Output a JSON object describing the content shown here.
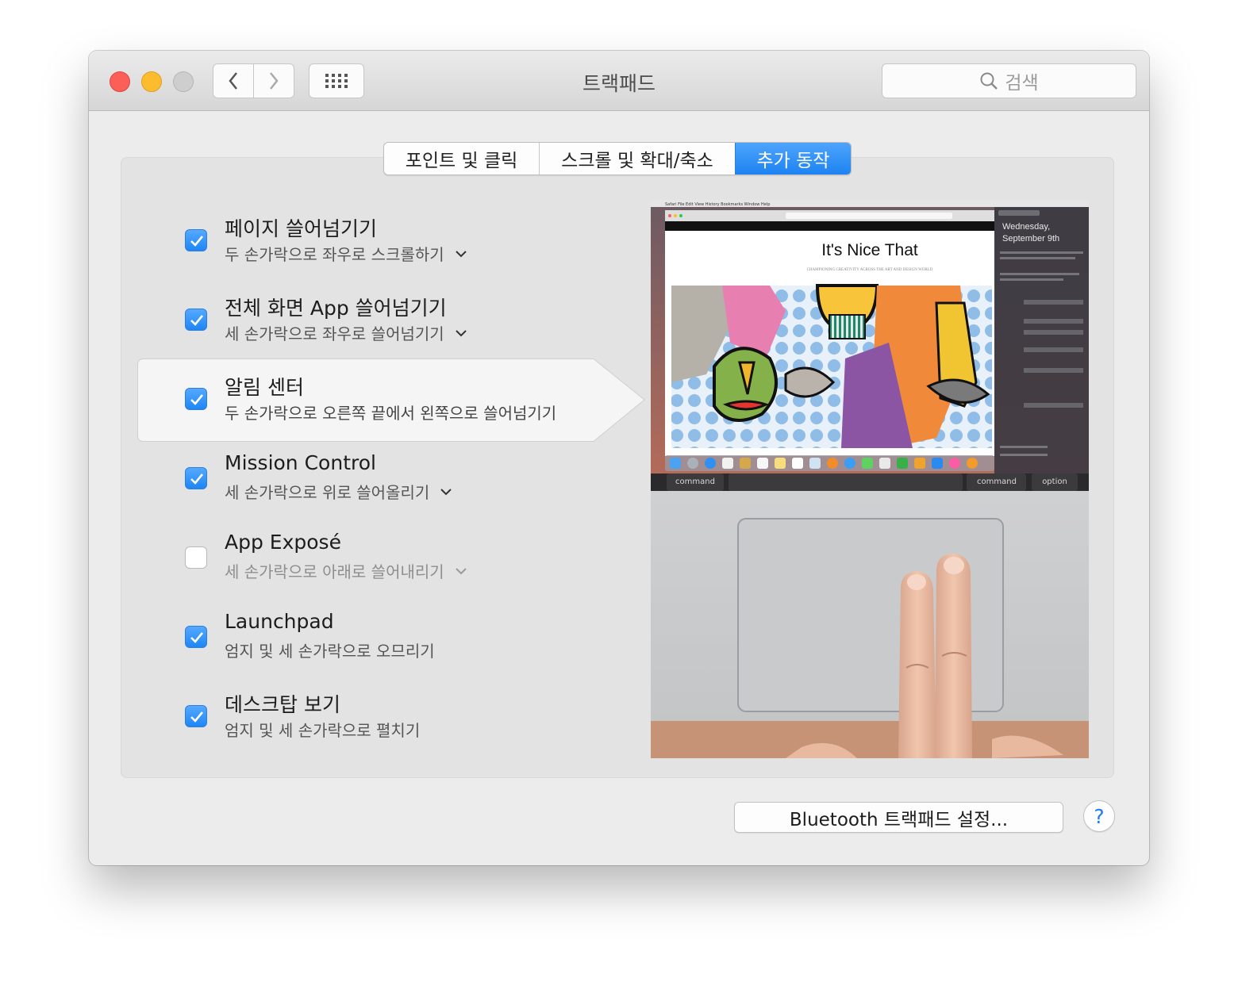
{
  "window": {
    "title": "트랙패드"
  },
  "search": {
    "placeholder": "검색"
  },
  "tabs": [
    {
      "label": "포인트 및 클릭",
      "active": false
    },
    {
      "label": "스크롤 및 확대/축소",
      "active": false
    },
    {
      "label": "추가 동작",
      "active": true
    }
  ],
  "options": [
    {
      "title": "페이지 쓸어넘기기",
      "subtitle": "두 손가락으로 좌우로 스크롤하기",
      "checked": true,
      "has_dropdown": true
    },
    {
      "title": "전체 화면 App 쓸어넘기기",
      "subtitle": "세 손가락으로 좌우로 쓸어넘기기",
      "checked": true,
      "has_dropdown": true
    },
    {
      "title": "알림 센터",
      "subtitle": "두 손가락으로 오른쪽 끝에서 왼쪽으로 쓸어넘기기",
      "checked": true,
      "has_dropdown": false,
      "selected": true
    },
    {
      "title": "Mission Control",
      "subtitle": "세 손가락으로 위로 쓸어올리기",
      "checked": true,
      "has_dropdown": true
    },
    {
      "title": "App Exposé",
      "subtitle": "세 손가락으로 아래로 쓸어내리기",
      "checked": false,
      "has_dropdown": true
    },
    {
      "title": "Launchpad",
      "subtitle": "엄지 및 세 손가락으로 오므리기",
      "checked": true,
      "has_dropdown": false
    },
    {
      "title": "데스크탑 보기",
      "subtitle": "엄지 및 세 손가락으로 펼치기",
      "checked": true,
      "has_dropdown": false
    }
  ],
  "preview": {
    "website_title": "It's Nice That",
    "website_tagline": "CHAMPIONING CREATIVITY ACROSS THE ART AND DESIGN WORLD",
    "nc_date_line1": "Wednesday,",
    "nc_date_line2": "September 9th",
    "key_command_left": "command",
    "key_command_right": "command",
    "key_option": "option"
  },
  "footer": {
    "bluetooth_button": "Bluetooth 트랙패드 설정...",
    "help_label": "?"
  },
  "colors": {
    "accent": "#1d83f2",
    "close": "#fc5f57",
    "minimize": "#fdbc2e",
    "zoom": "#cecece"
  }
}
